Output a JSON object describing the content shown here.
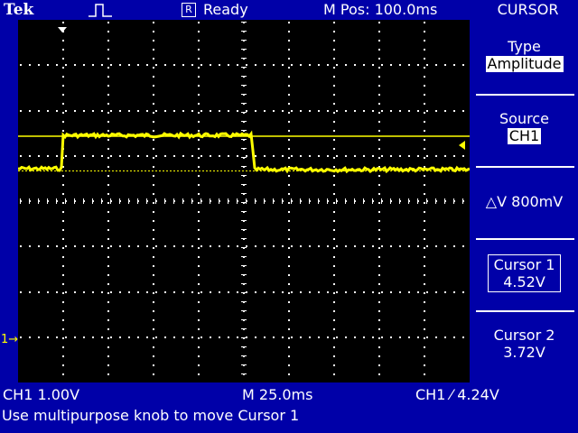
{
  "header": {
    "brand": "Tek",
    "trigger_icon": "pulse-trigger-icon",
    "state_letter": "R",
    "state": "Ready",
    "mpos": "M Pos: 100.0ms"
  },
  "menu": {
    "title": "CURSOR",
    "type_label": "Type",
    "type_value": "Amplitude",
    "source_label": "Source",
    "source_value": "CH1",
    "delta": "△V 800mV",
    "cursor1_label": "Cursor 1",
    "cursor1_value": "4.52V",
    "cursor2_label": "Cursor 2",
    "cursor2_value": "3.72V"
  },
  "status": {
    "channel_scale": "CH1  1.00V",
    "timebase": "M 25.0ms",
    "trigger": "CH1 ⁄ 4.24V",
    "message": "Use multipurpose knob to move Cursor 1"
  },
  "markers": {
    "channel_ref": "1→"
  },
  "colors": {
    "frame": "#0000a8",
    "screen": "#000000",
    "trace": "#ffff00",
    "grid": "#ffffff"
  }
}
